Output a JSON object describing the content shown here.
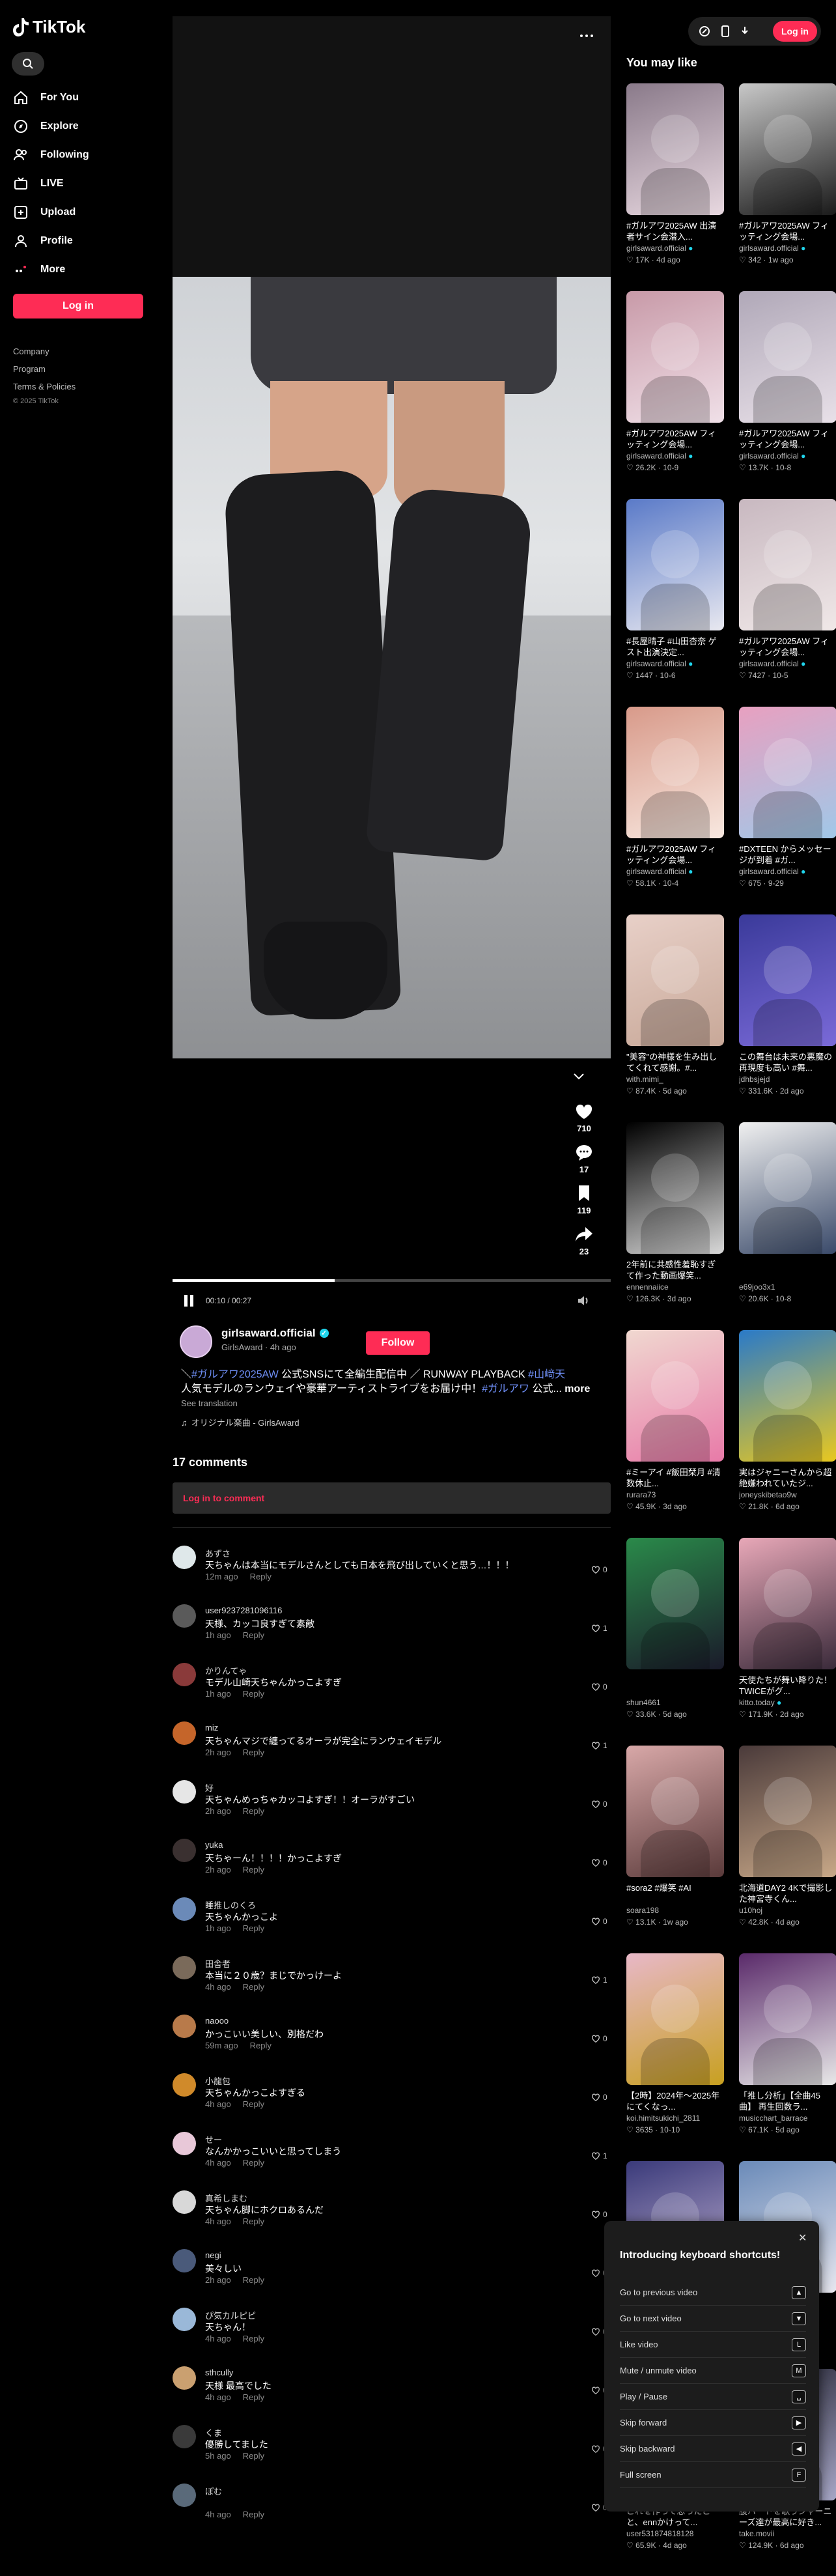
{
  "brand": {
    "name": "TikTok",
    "accent": "#fe2c55",
    "link_color": "#6e8ef5"
  },
  "sidebar": {
    "nav": [
      {
        "label": "For You",
        "icon": "home-icon"
      },
      {
        "label": "Explore",
        "icon": "compass-icon"
      },
      {
        "label": "Following",
        "icon": "following-icon"
      },
      {
        "label": "LIVE",
        "icon": "live-icon"
      },
      {
        "label": "Upload",
        "icon": "upload-icon"
      },
      {
        "label": "Profile",
        "icon": "profile-icon"
      },
      {
        "label": "More",
        "icon": "more-icon"
      }
    ],
    "login_label": "Log in",
    "footer": [
      "Company",
      "Program",
      "Terms & Policies",
      "© 2025 TikTok"
    ]
  },
  "topbar": {
    "login_label": "Log in"
  },
  "video": {
    "time": "00:10 / 00:27",
    "progress": 0.37,
    "actions": [
      {
        "icon": "heart-icon",
        "count": "710"
      },
      {
        "icon": "comment-icon",
        "count": "17"
      },
      {
        "icon": "bookmark-icon",
        "count": "119"
      },
      {
        "icon": "share-icon",
        "count": "23"
      }
    ]
  },
  "author": {
    "username": "girlsaward.official",
    "nickname": "GirlsAward",
    "time": "4h ago",
    "follow_label": "Follow",
    "desc_pre": "＼",
    "desc_tag1": "#ガルアワ2025AW",
    "desc_mid": " 公式SNSにて全編生配信中 ／ RUNWAY PLAYBACK ",
    "desc_tag2": "#山﨑天",
    "desc_line2": " 人気モデルのランウェイや豪華アーティストライブをお届け中！",
    "desc_tag3": "#ガルアワ",
    "desc_end": " 公式...",
    "more_label": "more",
    "see_translation": "See translation",
    "sound": "オリジナル楽曲 - GirlsAward"
  },
  "comments_section": {
    "count_label": "17 comments",
    "login_prompt": "Log in to comment",
    "reply_label": "Reply",
    "items": [
      {
        "user": "あずさ",
        "text": "天ちゃんは本当にモデルさんとしても日本を飛び出していくと思う…！！！",
        "time": "12m ago",
        "likes": "0",
        "avatar": "#dfe8ea"
      },
      {
        "user": "user9237281096116",
        "text": "天様、カッコ良すぎて素敵",
        "time": "1h ago",
        "likes": "1",
        "avatar": "#5a5a5a"
      },
      {
        "user": "かりんてゃ",
        "text": "モデル山崎天ちゃんかっこよすぎ",
        "time": "1h ago",
        "likes": "0",
        "avatar": "#8a3a3a"
      },
      {
        "user": "miz",
        "text": "天ちゃんマジで纏ってるオーラが完全にランウェイモデル",
        "time": "2h ago",
        "likes": "1",
        "avatar": "#c5652a"
      },
      {
        "user": "好",
        "text": "天ちゃんめっちゃカッコよすぎ！！オーラがすごい",
        "time": "2h ago",
        "likes": "0",
        "avatar": "#e6e6e6"
      },
      {
        "user": "yuka",
        "text": "天ちゃーん！！！！かっこよすぎ",
        "time": "2h ago",
        "likes": "0",
        "avatar": "#3a3030"
      },
      {
        "user": "睡推しのくろ",
        "text": "天ちゃんかっこよ",
        "time": "1h ago",
        "likes": "0",
        "avatar": "#6b8ab8"
      },
      {
        "user": "田舎者",
        "text": "本当に２０歳？まじでかっけーよ",
        "time": "4h ago",
        "likes": "1",
        "avatar": "#7a6a5a"
      },
      {
        "user": "naooo",
        "text": "かっこいい美しい、別格だわ",
        "time": "59m ago",
        "likes": "0",
        "avatar": "#b87a4a"
      },
      {
        "user": "小龍包",
        "text": "天ちゃんかっこよすぎる",
        "time": "4h ago",
        "likes": "0",
        "avatar": "#d08a2a"
      },
      {
        "user": "せー",
        "text": "なんかかっこいいと思ってしまう",
        "time": "4h ago",
        "likes": "1",
        "avatar": "#e8c8d8"
      },
      {
        "user": "真希しまむ",
        "text": "天ちゃん脚にホクロあるんだ",
        "time": "4h ago",
        "likes": "0",
        "avatar": "#d8d8d8"
      },
      {
        "user": "negi",
        "text": "美々しい",
        "time": "2h ago",
        "likes": "0",
        "avatar": "#4a5a7a"
      },
      {
        "user": "ぴ気カルピピ",
        "text": "天ちゃん！",
        "time": "4h ago",
        "likes": "0",
        "avatar": "#9ab8d8"
      },
      {
        "user": "sthcully",
        "text": "天様 最高でした",
        "time": "4h ago",
        "likes": "0",
        "avatar": "#caa070"
      },
      {
        "user": "くま",
        "text": "優勝してました",
        "time": "5h ago",
        "likes": "0",
        "avatar": "#3a3a3a"
      },
      {
        "user": "ぽむ",
        "text": "",
        "time": "4h ago",
        "likes": "0",
        "avatar": "#5a6a7a"
      }
    ]
  },
  "recommendations": {
    "title": "You may like",
    "items": [
      {
        "caption": "#ガルアワ2025AW 出演者サイン会潜入...",
        "author": "girlsaward.official",
        "verified": true,
        "views": "17K",
        "date": "4d ago",
        "colors": [
          "#8a7a8a",
          "#e8d8e0"
        ]
      },
      {
        "caption": "#ガルアワ2025AW フィッティング会場...",
        "author": "girlsaward.official",
        "verified": true,
        "views": "342",
        "date": "1w ago",
        "colors": [
          "#c8c8c8",
          "#1a1a1a"
        ]
      },
      {
        "caption": "#ガルアワ2025AW フィッティング会場...",
        "author": "girlsaward.official",
        "verified": true,
        "views": "26.2K",
        "date": "10-9",
        "colors": [
          "#c89aa8",
          "#f0e0e8"
        ]
      },
      {
        "caption": "#ガルアワ2025AW フィッティング会場...",
        "author": "girlsaward.official",
        "verified": true,
        "views": "13.7K",
        "date": "10-8",
        "colors": [
          "#b0a8b8",
          "#e8e0e8"
        ]
      },
      {
        "caption": "#長屋晴子 #山田杏奈 ゲスト出演決定...",
        "author": "girlsaward.official",
        "verified": true,
        "views": "1447",
        "date": "10-6",
        "colors": [
          "#5a7ac8",
          "#e8e8f0"
        ]
      },
      {
        "caption": "#ガルアワ2025AW フィッティング会場...",
        "author": "girlsaward.official",
        "verified": true,
        "views": "7427",
        "date": "10-5",
        "colors": [
          "#c8b8c0",
          "#f0e8e8"
        ]
      },
      {
        "caption": "#ガルアワ2025AW フィッティング会場...",
        "author": "girlsaward.official",
        "verified": true,
        "views": "58.1K",
        "date": "10-4",
        "colors": [
          "#d89a8a",
          "#f8e8e0"
        ]
      },
      {
        "caption": "#DXTEEN からメッセージが到着 #ガ...",
        "author": "girlsaward.official",
        "verified": true,
        "views": "675",
        "date": "9-29",
        "colors": [
          "#e8a0c0",
          "#a0c8e8"
        ]
      },
      {
        "caption": "\"美容\"の神様を生み出してくれて感謝。#...",
        "author": "with.mimi_",
        "verified": false,
        "views": "87.4K",
        "date": "5d ago",
        "colors": [
          "#e8d0c8",
          "#c8a898"
        ]
      },
      {
        "caption": "この舞台は未来の悪魔の再現度も高い #舞...",
        "author": "jdhbsjejd",
        "verified": false,
        "views": "331.6K",
        "date": "2d ago",
        "colors": [
          "#3a3a9a",
          "#7a6ad8"
        ]
      },
      {
        "caption": "2年前に共感性羞恥すぎて作った動画爆笑...",
        "author": "ennennaiice",
        "verified": false,
        "views": "126.3K",
        "date": "3d ago",
        "colors": [
          "#000000",
          "#d8d8d8"
        ]
      },
      {
        "caption": "",
        "author": "e69joo3x1",
        "verified": false,
        "views": "20.6K",
        "date": "10-8",
        "colors": [
          "#f0f0f0",
          "#3a4a6a"
        ]
      },
      {
        "caption": "#ミーアイ #飯田栞月 #清数休止...",
        "author": "rurara73",
        "verified": false,
        "views": "45.9K",
        "date": "3d ago",
        "colors": [
          "#f0d8d0",
          "#e87aa8"
        ]
      },
      {
        "caption": "実はジャニーさんから超絶嫌われていたジ...",
        "author": "joneyskibetao9w",
        "verified": false,
        "views": "21.8K",
        "date": "6d ago",
        "colors": [
          "#2a7ac8",
          "#e8c820"
        ]
      },
      {
        "caption": "",
        "author": "shun4661",
        "verified": false,
        "views": "33.6K",
        "date": "5d ago",
        "colors": [
          "#2a8a4a",
          "#1a1a2a"
        ]
      },
      {
        "caption": "天使たちが舞い降りた！ TWICEがグ...",
        "author": "kitto.today",
        "verified": true,
        "views": "171.9K",
        "date": "2d ago",
        "colors": [
          "#e8a8b8",
          "#3a2a3a"
        ]
      },
      {
        "caption": "#sora2 #爆笑 #AI",
        "author": "soara198",
        "verified": false,
        "views": "13.1K",
        "date": "1w ago",
        "colors": [
          "#d8a8a8",
          "#5a3a3a"
        ]
      },
      {
        "caption": "北海道DAY2 4Kで撮影した神宮寺くん...",
        "author": "u10hoj",
        "verified": false,
        "views": "42.8K",
        "date": "4d ago",
        "colors": [
          "#4a3a3a",
          "#c8a888"
        ]
      },
      {
        "caption": "【2時】2024年〜2025年にてくなっ...",
        "author": "koi.himitsukichi_2811",
        "verified": false,
        "views": "3635",
        "date": "10-10",
        "colors": [
          "#e8b8c8",
          "#c8a020"
        ]
      },
      {
        "caption": "「推し分析」【全曲45曲】 再生回数ラ...",
        "author": "musicchart_barrace",
        "verified": false,
        "views": "67.1K",
        "date": "5d ago",
        "colors": [
          "#5a2a6a",
          "#e8e8e8"
        ]
      },
      {
        "caption": "",
        "author": "",
        "verified": false,
        "views": "",
        "date": "",
        "colors": [
          "#3a3a7a",
          "#c8b8d8"
        ]
      },
      {
        "caption": "",
        "author": "",
        "verified": false,
        "views": "",
        "date": "",
        "colors": [
          "#6a8ab8",
          "#e8e8f0"
        ]
      },
      {
        "caption": "これを作って思ったこと、ennかけって...",
        "author": "user531874818128",
        "verified": false,
        "views": "65.9K",
        "date": "4d ago",
        "colors": [
          "#3a3a3a",
          "#d8c8b8"
        ]
      },
      {
        "caption": "腹パートを歌うジャーニーズ達が最高に好き...",
        "author": "take.movii",
        "verified": false,
        "views": "124.9K",
        "date": "6d ago",
        "colors": [
          "#2a2a3a",
          "#a8a8c8"
        ]
      }
    ]
  },
  "keyboard_popup": {
    "title": "Introducing keyboard shortcuts!",
    "rows": [
      {
        "label": "Go to previous video",
        "key": "▲"
      },
      {
        "label": "Go to next video",
        "key": "▼"
      },
      {
        "label": "Like video",
        "key": "L"
      },
      {
        "label": "Mute / unmute video",
        "key": "M"
      },
      {
        "label": "Play / Pause",
        "key": "␣"
      },
      {
        "label": "Skip forward",
        "key": "▶"
      },
      {
        "label": "Skip backward",
        "key": "◀"
      },
      {
        "label": "Full screen",
        "key": "F"
      }
    ]
  }
}
